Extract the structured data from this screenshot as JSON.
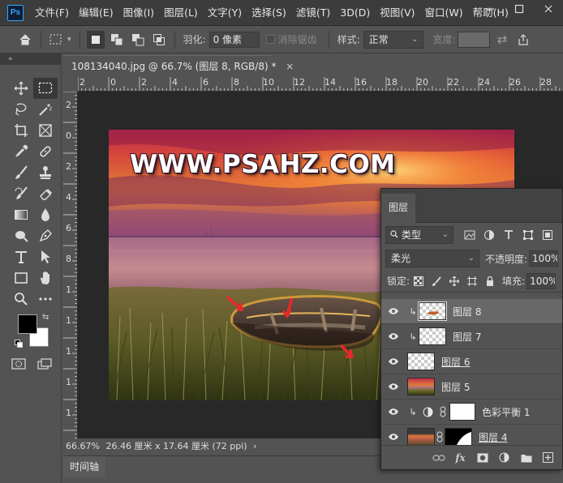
{
  "app": {
    "logo": "Ps"
  },
  "menu": [
    "文件(F)",
    "编辑(E)",
    "图像(I)",
    "图层(L)",
    "文字(Y)",
    "选择(S)",
    "滤镜(T)",
    "3D(D)",
    "视图(V)",
    "窗口(W)",
    "帮助(H)"
  ],
  "window_controls": [
    "minimize-icon",
    "maximize-icon",
    "close-icon"
  ],
  "options": {
    "feather_label": "羽化:",
    "feather_value": "0 像素",
    "antialias_label": "消除锯齿",
    "style_label": "样式:",
    "style_value": "正常",
    "width_label": "宽度:"
  },
  "document": {
    "tab_title": "108134040.jpg @ 66.7% (图层 8, RGB/8) *",
    "close_glyph": "×",
    "watermark": "WWW.PSAHZ.COM",
    "ruler_top": [
      "2",
      "0",
      "2",
      "4",
      "6",
      "8",
      "10",
      "12",
      "14",
      "16",
      "18",
      "20",
      "22",
      "24",
      "26",
      "28"
    ],
    "ruler_left": [
      "2",
      "0",
      "2",
      "4",
      "6",
      "8",
      "1",
      "1",
      "1",
      "1",
      "1"
    ],
    "zoom": "66.67%",
    "doc_info": "26.46 厘米 x 17.64 厘米 (72 ppi)",
    "status_arrow": "›"
  },
  "timeline": {
    "tab_label": "时间轴"
  },
  "layers_panel": {
    "tab_label": "图层",
    "filter_label": "类型",
    "blend_mode": "柔光",
    "opacity_label": "不透明度:",
    "opacity_value": "100%",
    "lock_label": "锁定:",
    "fill_label": "填充:",
    "fill_value": "100%",
    "layers": [
      {
        "name": "图层 8",
        "selected": true,
        "clipped": true,
        "thumb": "checker-boat"
      },
      {
        "name": "图层 7",
        "selected": false,
        "clipped": true,
        "thumb": "checker"
      },
      {
        "name": "图层 6",
        "selected": false,
        "clipped": false,
        "thumb": "checker"
      },
      {
        "name": "图层 5",
        "selected": false,
        "clipped": false,
        "thumb": "photo"
      },
      {
        "name": "色彩平衡 1",
        "selected": false,
        "clipped": true,
        "thumb": "adjustment"
      },
      {
        "name": "图层 4",
        "selected": false,
        "clipped": false,
        "thumb": "photo-mask"
      }
    ],
    "bottom_icons": [
      "link-icon",
      "fx-icon",
      "mask-icon",
      "adjustment-icon",
      "folder-icon",
      "new-layer-icon"
    ],
    "fx_label": "fx"
  },
  "colors": {
    "foreground": "#000000",
    "background": "#ffffff",
    "ui_dark": "#3c3c3c",
    "ui_panel": "#535353",
    "accent": "#31a8ff"
  }
}
